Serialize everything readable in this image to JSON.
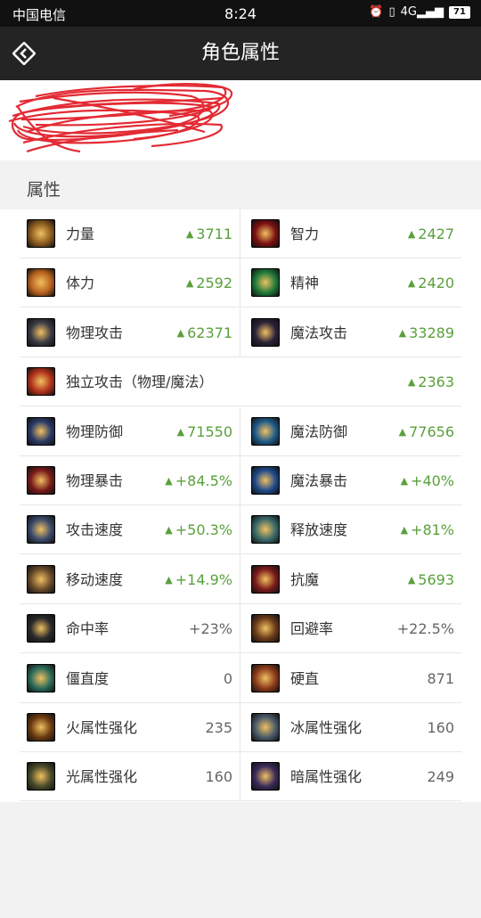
{
  "status": {
    "carrier": "中国电信",
    "time": "8:24",
    "signal": "4G",
    "battery": "71"
  },
  "appbar": {
    "title": "角色属性"
  },
  "section": {
    "title": "属性"
  },
  "attributes": [
    {
      "left": {
        "label": "力量",
        "value": "3711",
        "up": true
      },
      "right": {
        "label": "智力",
        "value": "2427",
        "up": true
      }
    },
    {
      "left": {
        "label": "体力",
        "value": "2592",
        "up": true
      },
      "right": {
        "label": "精神",
        "value": "2420",
        "up": true
      }
    },
    {
      "left": {
        "label": "物理攻击",
        "value": "62371",
        "up": true
      },
      "right": {
        "label": "魔法攻击",
        "value": "33289",
        "up": true
      }
    },
    {
      "full": {
        "label": "独立攻击（物理/魔法）",
        "value": "2363",
        "up": true
      }
    },
    {
      "left": {
        "label": "物理防御",
        "value": "71550",
        "up": true
      },
      "right": {
        "label": "魔法防御",
        "value": "77656",
        "up": true
      }
    },
    {
      "left": {
        "label": "物理暴击",
        "value": "+84.5%",
        "up": true
      },
      "right": {
        "label": "魔法暴击",
        "value": "+40%",
        "up": true
      }
    },
    {
      "left": {
        "label": "攻击速度",
        "value": "+50.3%",
        "up": true
      },
      "right": {
        "label": "释放速度",
        "value": "+81%",
        "up": true
      }
    },
    {
      "left": {
        "label": "移动速度",
        "value": "+14.9%",
        "up": true
      },
      "right": {
        "label": "抗魔",
        "value": "5693",
        "up": true
      }
    },
    {
      "left": {
        "label": "命中率",
        "value": "+23%",
        "up": false
      },
      "right": {
        "label": "回避率",
        "value": "+22.5%",
        "up": false
      }
    },
    {
      "left": {
        "label": "僵直度",
        "value": "0",
        "up": false
      },
      "right": {
        "label": "硬直",
        "value": "871",
        "up": false
      }
    },
    {
      "left": {
        "label": "火属性强化",
        "value": "235",
        "up": false
      },
      "right": {
        "label": "冰属性强化",
        "value": "160",
        "up": false
      }
    },
    {
      "left": {
        "label": "光属性强化",
        "value": "160",
        "up": false
      },
      "right": {
        "label": "暗属性强化",
        "value": "249",
        "up": false
      }
    }
  ],
  "icon_names": [
    [
      "strength-icon",
      "intelligence-icon"
    ],
    [
      "vitality-icon",
      "spirit-icon"
    ],
    [
      "physical-attack-icon",
      "magic-attack-icon"
    ],
    [
      "independent-attack-icon"
    ],
    [
      "physical-defense-icon",
      "magic-defense-icon"
    ],
    [
      "physical-crit-icon",
      "magic-crit-icon"
    ],
    [
      "attack-speed-icon",
      "cast-speed-icon"
    ],
    [
      "move-speed-icon",
      "magic-resist-icon"
    ],
    [
      "hit-rate-icon",
      "evasion-icon"
    ],
    [
      "stiffness-icon",
      "hit-stun-icon"
    ],
    [
      "fire-enhance-icon",
      "ice-enhance-icon"
    ],
    [
      "light-enhance-icon",
      "dark-enhance-icon"
    ]
  ],
  "icon_colors": [
    [
      "#8a5a1e",
      "#7a1010"
    ],
    [
      "#b8621e",
      "#1f7a3a"
    ],
    [
      "#3a3a44",
      "#2a2238"
    ],
    [
      "#b0301a"
    ],
    [
      "#2a3a66",
      "#1f5a8a"
    ],
    [
      "#7a1a1a",
      "#1f4a8a"
    ],
    [
      "#3a4a6a",
      "#3a6a6a"
    ],
    [
      "#6a4a2a",
      "#7a1a1a"
    ],
    [
      "#2a2a2a",
      "#6a3a1a"
    ],
    [
      "#2a6a5a",
      "#8a3a1a"
    ],
    [
      "#6a3a10",
      "#4a5a6a"
    ],
    [
      "#4a4a2a",
      "#3a2a5a"
    ]
  ],
  "colors": {
    "up": "#5aa03c",
    "appbar": "#242424",
    "scribble": "#e0141e"
  }
}
